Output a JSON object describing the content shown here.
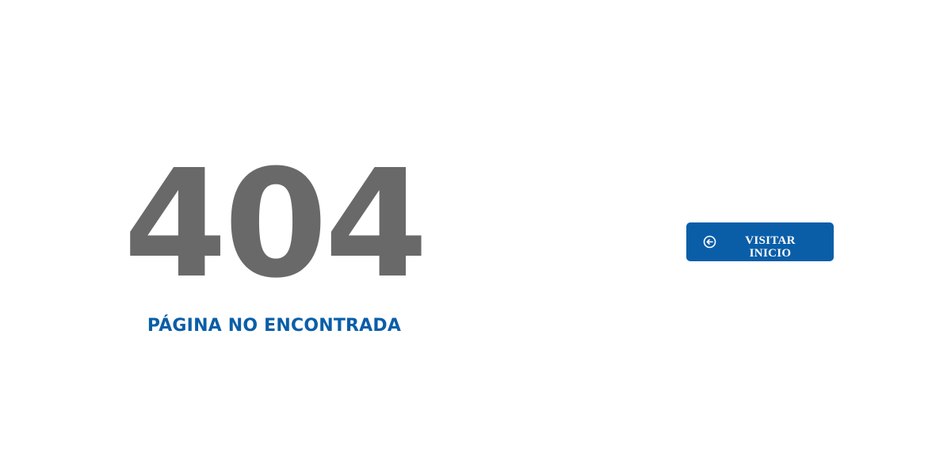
{
  "error": {
    "code": "404",
    "message": "PÁGINA NO ENCONTRADA"
  },
  "home_button": {
    "label_line1": "VISITAR",
    "label_line2": "INICIO",
    "icon": "arrow-left-circle-icon"
  },
  "colors": {
    "code_gray": "#696969",
    "brand_blue": "#0a5ea8",
    "background": "#ffffff"
  }
}
